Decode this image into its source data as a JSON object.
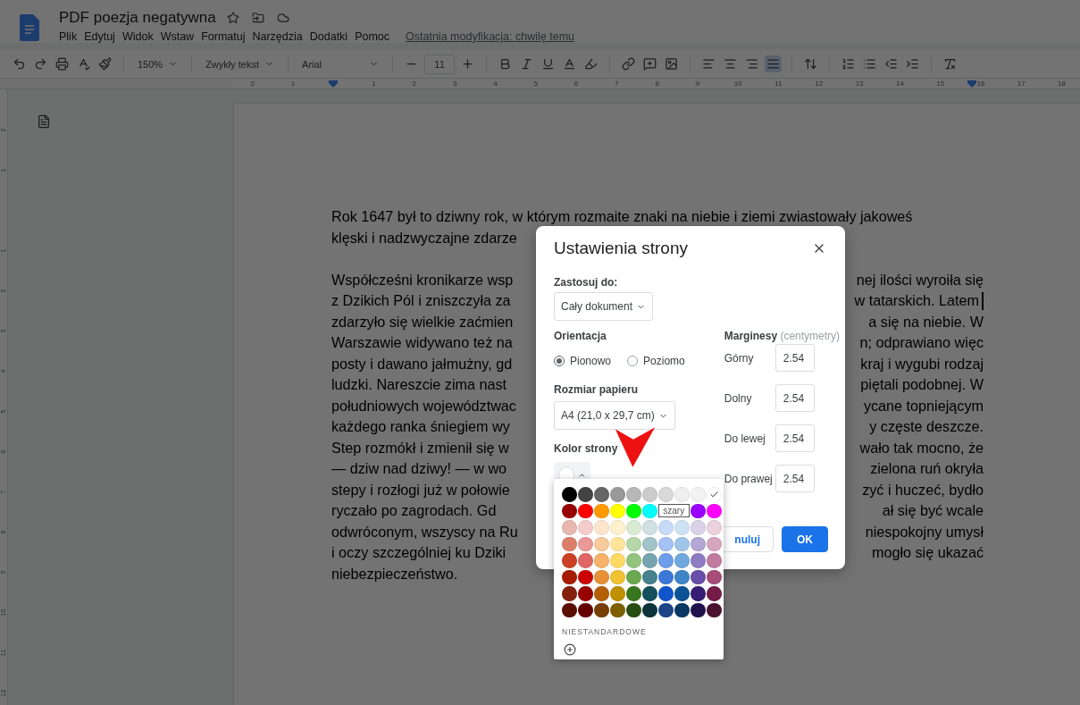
{
  "document": {
    "title": "PDF poezja negatywna",
    "menu": [
      "Plik",
      "Edytuj",
      "Widok",
      "Wstaw",
      "Formatuj",
      "Narzędzia",
      "Dodatki",
      "Pomoc"
    ],
    "last_edit": "Ostatnia modyfikacja: chwilę temu"
  },
  "toolbar": {
    "zoom": "150%",
    "style": "Zwykły tekst",
    "font": "Arial",
    "font_size": "11",
    "alignment": [
      {
        "selected": false
      },
      {
        "selected": false
      },
      {
        "selected": false
      },
      {
        "selected": true
      }
    ]
  },
  "ruler": {
    "before": [
      "2",
      "1"
    ],
    "after": [
      "1",
      "2",
      "3",
      "4",
      "5",
      "6",
      "7",
      "8",
      "9",
      "10",
      "11",
      "12",
      "13",
      "14",
      "15",
      "16",
      "17",
      "18"
    ]
  },
  "vertical_ruler": {
    "before": [
      "2",
      "1"
    ],
    "after": [
      "1",
      "2",
      "3",
      "4",
      "5",
      "6",
      "7",
      "8",
      "9",
      "10",
      "11",
      "12"
    ]
  },
  "body": {
    "paragraphs": [
      {
        "lines": [
          {
            "left": "Rok 1647 był to dziwny rok, w którym rozmaite znaki na niebie i ziemi zwiastowały jakoweś"
          },
          {
            "left": "klęski i nadzwyczajne zdarze"
          }
        ]
      },
      {
        "lines": [
          {
            "left": "Współcześni kronikarze wsp",
            "right": "nej ilości wyroiła się"
          },
          {
            "left": "z Dzikich Pól i zniszczyła za",
            "right": "w tatarskich. Latem",
            "cursor": true
          },
          {
            "left": "zdarzyło się wielkie zaćmien",
            "right": "a się na niebie. W"
          },
          {
            "left": "Warszawie widywano też na",
            "right": "n; odprawiano więc"
          },
          {
            "left": "posty i dawano jałmużny, gd",
            "right": "kraj i wygubi rodzaj"
          },
          {
            "left": "ludzki. Nareszcie zima nast",
            "right": "piętali podobnej. W"
          },
          {
            "left": "południowych województwac",
            "right": "ycane topniejącym"
          },
          {
            "left": "każdego ranka śniegiem wy",
            "right": "y częste deszcze."
          },
          {
            "left": "Step rozmókł i zmienił się w",
            "right": "wało tak mocno, że"
          },
          {
            "left": "— dziw nad dziwy! — w wo",
            "right": "zielona ruń okryła"
          },
          {
            "left": "stepy i rozłogi już w połowie",
            "right": "zyć i huczeć, bydło"
          },
          {
            "left": "ryczało po zagrodach. Gd",
            "right": "ał się być wcale"
          },
          {
            "left": "odwróconym, wszyscy na Ru",
            "right": "niespokojny umysł"
          },
          {
            "left": "i oczy szczególniej ku Dziki",
            "right": "mogło się ukazać"
          },
          {
            "left": "niebezpieczeństwo."
          }
        ]
      }
    ]
  },
  "dialog": {
    "title": "Ustawienia strony",
    "apply_label": "Zastosuj do:",
    "apply_value": "Cały dokument",
    "orientation_label": "Orientacja",
    "orientations": [
      {
        "label": "Pionowo",
        "selected": true
      },
      {
        "label": "Poziomo",
        "selected": false
      }
    ],
    "paper_label": "Rozmiar papieru",
    "paper_value": "A4 (21,0 x 29,7 cm)",
    "color_label": "Kolor strony",
    "margins_label": "Marginesy",
    "margins_unit": "(centymetry)",
    "margins": [
      {
        "label": "Górny",
        "value": "2.54"
      },
      {
        "label": "Dolny",
        "value": "2.54"
      },
      {
        "label": "Do lewej",
        "value": "2.54"
      },
      {
        "label": "Do prawej",
        "value": "2.54"
      }
    ],
    "cancel": "nuluj",
    "ok": "OK"
  },
  "palette": {
    "custom_label": "NIESTANDARDOWE",
    "rows": [
      [
        {
          "color": "#000000",
          "selected": false
        },
        {
          "color": "#434343",
          "selected": false
        },
        {
          "color": "#666666",
          "selected": false
        },
        {
          "color": "#999999",
          "selected": false
        },
        {
          "color": "#b7b7b7",
          "selected": false
        },
        {
          "color": "#cccccc",
          "selected": false
        },
        {
          "color": "#d9d9d9",
          "selected": false
        },
        {
          "color": "#efefef",
          "selected": false
        },
        {
          "color": "#f3f3f3",
          "selected": false
        },
        {
          "color": "#ffffff",
          "selected": true
        }
      ],
      [
        {
          "kind": "swatch",
          "color": "#980000",
          "selected": false
        },
        {
          "kind": "swatch",
          "color": "#ff0000",
          "selected": false
        },
        {
          "kind": "swatch",
          "color": "#ff9900",
          "selected": false
        },
        {
          "kind": "swatch",
          "color": "#ffff00",
          "selected": false
        },
        {
          "kind": "swatch",
          "color": "#00ff00",
          "selected": false
        },
        {
          "kind": "swatch",
          "color": "#00ffff",
          "selected": false
        },
        {
          "kind": "tooltip",
          "label": "szary"
        },
        {
          "kind": "swatch",
          "color": "#9900ff",
          "selected": false
        },
        {
          "kind": "swatch",
          "color": "#ff00ff",
          "selected": false
        }
      ],
      [
        {
          "color": "#e6b8af",
          "selected": false
        },
        {
          "color": "#f4cccc",
          "selected": false
        },
        {
          "color": "#fce5cd",
          "selected": false
        },
        {
          "color": "#fff2cc",
          "selected": false
        },
        {
          "color": "#d9ead3",
          "selected": false
        },
        {
          "color": "#d0e0e3",
          "selected": false
        },
        {
          "color": "#c9daf8",
          "selected": false
        },
        {
          "color": "#cfe2f3",
          "selected": false
        },
        {
          "color": "#d9d2e9",
          "selected": false
        },
        {
          "color": "#ead1dc",
          "selected": false
        }
      ],
      [
        {
          "color": "#dd7e6b",
          "selected": false
        },
        {
          "color": "#ea9999",
          "selected": false
        },
        {
          "color": "#f9cb9c",
          "selected": false
        },
        {
          "color": "#ffe599",
          "selected": false
        },
        {
          "color": "#b6d7a8",
          "selected": false
        },
        {
          "color": "#a2c4c9",
          "selected": false
        },
        {
          "color": "#a4c2f4",
          "selected": false
        },
        {
          "color": "#9fc5e8",
          "selected": false
        },
        {
          "color": "#b4a7d6",
          "selected": false
        },
        {
          "color": "#d5a6bd",
          "selected": false
        }
      ],
      [
        {
          "color": "#cc4125",
          "selected": false
        },
        {
          "color": "#e06666",
          "selected": false
        },
        {
          "color": "#f6b26b",
          "selected": false
        },
        {
          "color": "#ffd966",
          "selected": false
        },
        {
          "color": "#93c47d",
          "selected": false
        },
        {
          "color": "#76a5af",
          "selected": false
        },
        {
          "color": "#6d9eeb",
          "selected": false
        },
        {
          "color": "#6fa8dc",
          "selected": false
        },
        {
          "color": "#8e7cc3",
          "selected": false
        },
        {
          "color": "#c27ba0",
          "selected": false
        }
      ],
      [
        {
          "color": "#a61c00",
          "selected": false
        },
        {
          "color": "#cc0000",
          "selected": false
        },
        {
          "color": "#e69138",
          "selected": false
        },
        {
          "color": "#f1c232",
          "selected": false
        },
        {
          "color": "#6aa84f",
          "selected": false
        },
        {
          "color": "#45818e",
          "selected": false
        },
        {
          "color": "#3c78d8",
          "selected": false
        },
        {
          "color": "#3d85c6",
          "selected": false
        },
        {
          "color": "#674ea7",
          "selected": false
        },
        {
          "color": "#a64d79",
          "selected": false
        }
      ],
      [
        {
          "color": "#85200c",
          "selected": false
        },
        {
          "color": "#990000",
          "selected": false
        },
        {
          "color": "#b45f06",
          "selected": false
        },
        {
          "color": "#bf9000",
          "selected": false
        },
        {
          "color": "#38761d",
          "selected": false
        },
        {
          "color": "#134f5c",
          "selected": false
        },
        {
          "color": "#1155cc",
          "selected": false
        },
        {
          "color": "#0b5394",
          "selected": false
        },
        {
          "color": "#351c75",
          "selected": false
        },
        {
          "color": "#741b47",
          "selected": false
        }
      ],
      [
        {
          "color": "#5b0f00",
          "selected": false
        },
        {
          "color": "#660000",
          "selected": false
        },
        {
          "color": "#783f04",
          "selected": false
        },
        {
          "color": "#7f6000",
          "selected": false
        },
        {
          "color": "#274e13",
          "selected": false
        },
        {
          "color": "#0c343d",
          "selected": false
        },
        {
          "color": "#1c4587",
          "selected": false
        },
        {
          "color": "#073763",
          "selected": false
        },
        {
          "color": "#20124d",
          "selected": false
        },
        {
          "color": "#4c1130",
          "selected": false
        }
      ]
    ]
  }
}
